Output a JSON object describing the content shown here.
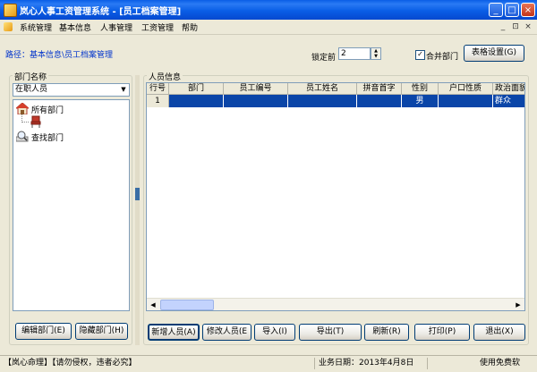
{
  "window": {
    "title": "岚心人事工资管理系统 - [员工档案管理]",
    "minimize_glyph": "_",
    "maximize_glyph": "□",
    "close_glyph": "×"
  },
  "menu": {
    "items": [
      "系统管理",
      "基本信息",
      "人事管理",
      "工资管理",
      "帮助"
    ]
  },
  "mdi_controls": [
    "_",
    "⊡",
    "×"
  ],
  "breadcrumb": "路径：基本信息\\员工档案管理",
  "lock": {
    "label": "锁定前",
    "value": "2"
  },
  "merge_dept": {
    "label": "合并部门",
    "checked": true
  },
  "table_settings_label": "表格设置(G)",
  "left_panel": {
    "group_label": "部门名称",
    "selected_filter": "在职人员",
    "tree": [
      {
        "label": "所有部门",
        "icon": "house-icon"
      },
      {
        "label": "",
        "icon": "chair-icon"
      },
      {
        "label": "查找部门",
        "icon": "search-icon"
      }
    ],
    "edit_button": "编辑部门(E)",
    "hide_button": "隐藏部门(H)"
  },
  "right_panel": {
    "group_label": "人员信息",
    "columns": [
      "行号",
      "部门",
      "员工编号",
      "员工姓名",
      "拼音首字",
      "性别",
      "户口性质",
      "政治面貌"
    ],
    "rows": [
      [
        "1",
        "",
        "",
        "",
        "",
        "男",
        "",
        "群众"
      ]
    ]
  },
  "buttons": {
    "add": "新增人员(A)",
    "edit": "修改人员(E",
    "import": "导入(I)",
    "export": "导出(T)",
    "refresh": "刷新(R)",
    "print": "打印(P)",
    "exit": "退出(X)"
  },
  "status": {
    "left": "【岚心命理】【请勿侵权，违者必究】",
    "date": "业务日期：2013年4月8日",
    "license": "使用免费软"
  },
  "colors": {
    "titlebar": "#0A5EE6",
    "selection": "#0A45A8",
    "link": "#0033CC"
  }
}
